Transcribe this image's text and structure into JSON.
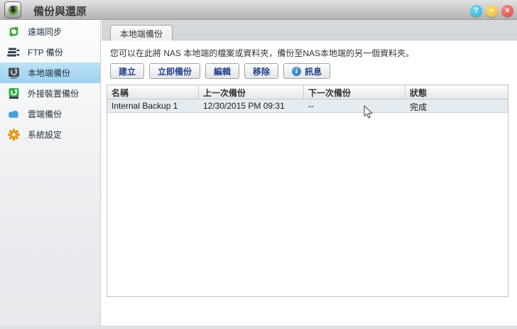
{
  "window": {
    "title": "備份與還原",
    "controls": {
      "help": "?",
      "minimize": "−",
      "close": "×"
    }
  },
  "sidebar": {
    "items": [
      {
        "label": "遠端同步",
        "icon": "remote-sync-icon",
        "selected": false
      },
      {
        "label": "FTP 備份",
        "icon": "ftp-backup-icon",
        "selected": false
      },
      {
        "label": "本地端備份",
        "icon": "local-backup-icon",
        "selected": true
      },
      {
        "label": "外接裝置備份",
        "icon": "external-device-icon",
        "selected": false
      },
      {
        "label": "雲端備份",
        "icon": "cloud-backup-icon",
        "selected": false
      },
      {
        "label": "系統設定",
        "icon": "system-settings-icon",
        "selected": false
      }
    ]
  },
  "main": {
    "tab": "本地端備份",
    "description": "您可以在此將 NAS 本地端的檔案或資料夾，備份至NAS本地端的另一個資料夾。",
    "toolbar": {
      "create": "建立",
      "backup_now": "立即備份",
      "edit": "編輯",
      "remove": "移除",
      "info": "訊息",
      "info_icon_glyph": "i"
    },
    "table": {
      "columns": [
        "名稱",
        "上一次備份",
        "下一次備份",
        "狀態"
      ],
      "rows": [
        {
          "name": "Internal Backup 1",
          "last_backup": "12/30/2015 PM 09:31",
          "next_backup": "--",
          "status": "完成"
        }
      ]
    }
  },
  "colors": {
    "sidebar_selected": "#a9d9f3",
    "button_text": "#24418c",
    "row_highlight": "#e4ebf1",
    "help_button": "#2eb3d8",
    "minimize_button": "#e8c02f",
    "close_button": "#e74343",
    "sync_green": "#3aa52f",
    "cloud_blue": "#4a9ddb",
    "gear_orange": "#e39a15"
  }
}
